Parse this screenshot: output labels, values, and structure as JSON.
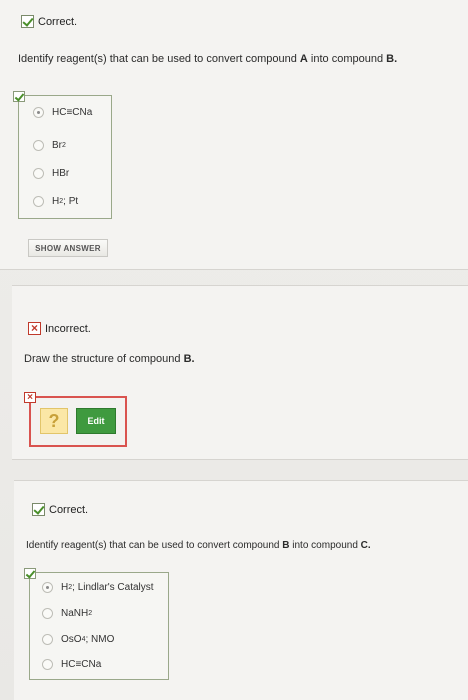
{
  "section1": {
    "status": "Correct.",
    "prompt_pre": "Identify reagent(s) that can be used to convert compound ",
    "prompt_a": "A",
    "prompt_mid": " into compound ",
    "prompt_b": "B.",
    "choices": [
      "HC≡CNa",
      "Br",
      "HBr",
      "H; Pt"
    ],
    "choice_subs": [
      "",
      "2",
      "",
      "2"
    ],
    "selected_index": 0,
    "show_answer_label": "SHOW ANSWER"
  },
  "section2": {
    "status": "Incorrect.",
    "prompt_pre": "Draw the structure of compound ",
    "prompt_b": "B.",
    "placeholder_glyph": "?",
    "edit_label": "Edit"
  },
  "section3": {
    "status": "Correct.",
    "prompt_pre": "Identify reagent(s) that can be used to convert compound ",
    "prompt_b": "B",
    "prompt_mid": " into compound ",
    "prompt_c": "C.",
    "choices": [
      "H; Lindlar's Catalyst",
      "NaNH",
      "OsO; NMO",
      "HC≡CNa"
    ],
    "choice_subs": [
      "2",
      "2",
      "4",
      ""
    ],
    "selected_index": 0
  },
  "colors": {
    "correct": "#4a8f2a",
    "incorrect": "#c0392b",
    "edit_button": "#3f9a3f"
  }
}
